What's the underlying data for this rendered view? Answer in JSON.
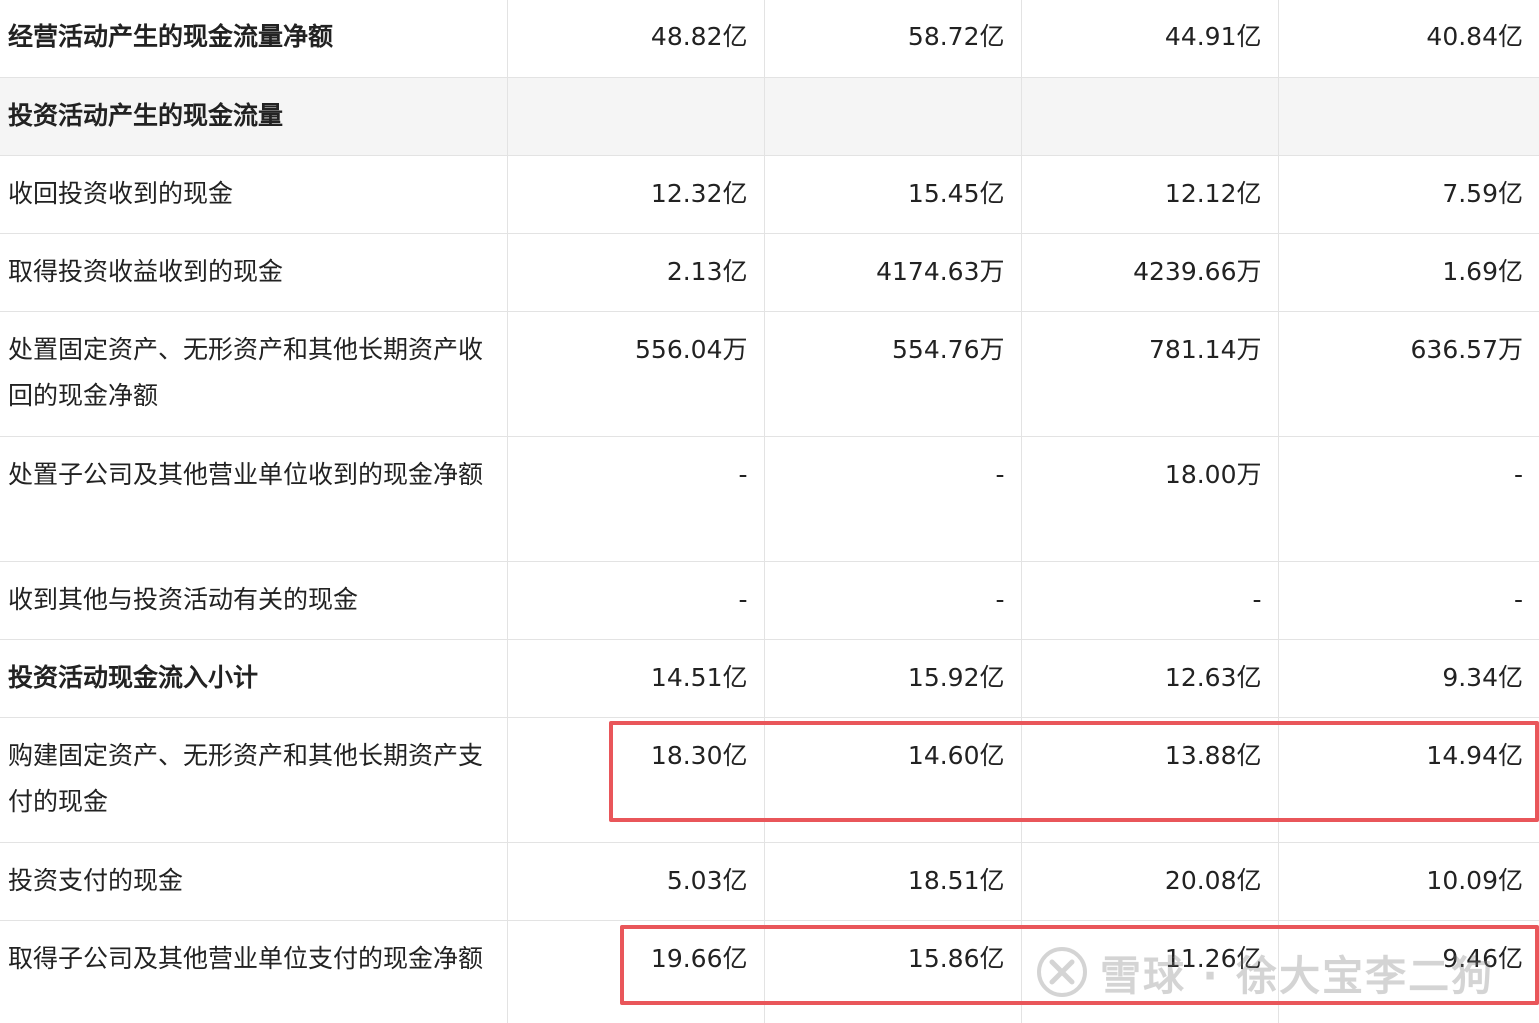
{
  "rows": [
    {
      "label": "经营活动产生的现金流量净额",
      "values": [
        "48.82亿",
        "58.72亿",
        "44.91亿",
        "40.84亿"
      ]
    },
    {
      "label": "投资活动产生的现金流量",
      "values": [
        "",
        "",
        "",
        ""
      ]
    },
    {
      "label": "收回投资收到的现金",
      "values": [
        "12.32亿",
        "15.45亿",
        "12.12亿",
        "7.59亿"
      ]
    },
    {
      "label": "取得投资收益收到的现金",
      "values": [
        "2.13亿",
        "4174.63万",
        "4239.66万",
        "1.69亿"
      ]
    },
    {
      "label": "处置固定资产、无形资产和其他长期资产收回的现金净额",
      "values": [
        "556.04万",
        "554.76万",
        "781.14万",
        "636.57万"
      ]
    },
    {
      "label": "处置子公司及其他营业单位收到的现金净额",
      "values": [
        "-",
        "-",
        "18.00万",
        "-"
      ]
    },
    {
      "label": "收到其他与投资活动有关的现金",
      "values": [
        "-",
        "-",
        "-",
        "-"
      ]
    },
    {
      "label": "投资活动现金流入小计",
      "values": [
        "14.51亿",
        "15.92亿",
        "12.63亿",
        "9.34亿"
      ]
    },
    {
      "label": "购建固定资产、无形资产和其他长期资产支付的现金",
      "values": [
        "18.30亿",
        "14.60亿",
        "13.88亿",
        "14.94亿"
      ]
    },
    {
      "label": "投资支付的现金",
      "values": [
        "5.03亿",
        "18.51亿",
        "20.08亿",
        "10.09亿"
      ]
    },
    {
      "label": "取得子公司及其他营业单位支付的现金净额",
      "values": [
        "19.66亿",
        "15.86亿",
        "11.26亿",
        "9.46亿"
      ]
    }
  ],
  "watermark": {
    "text": "雪球 · 徐大宝李二狗",
    "icon": "xueqiu-logo-icon"
  },
  "colors": {
    "highlight": "#e9565a",
    "section_bg": "#f5f5f5",
    "border": "#e3e3e3",
    "text": "#222222"
  }
}
